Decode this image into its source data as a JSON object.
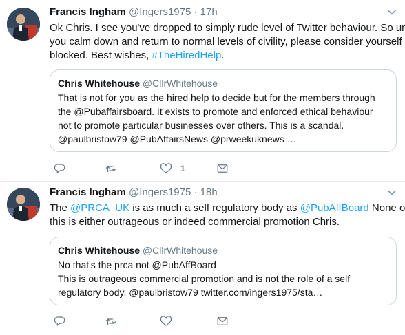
{
  "tweets": [
    {
      "author": {
        "name": "Francis Ingham",
        "handle": "@Ingers1975",
        "dot": "·",
        "time": "17h"
      },
      "text_lines": [
        [
          {
            "t": "Ok Chris. I see you've dropped to simply rude level of Twitter behaviour. So until"
          }
        ],
        [
          {
            "t": "you calm down and return to normal levels of civility, please consider yourself"
          }
        ],
        [
          {
            "t": "blocked. Best wishes, "
          },
          {
            "t": "#TheHiredHelp",
            "link": true
          },
          {
            "t": "."
          }
        ]
      ],
      "quote": {
        "name": "Chris Whitehouse",
        "handle": "@CllrWhitehouse",
        "lines": [
          "That is not for you as the hired help to decide but for the members through",
          "the @Pubaffairsboard. It exists to promote and enforced ethical behaviour",
          "not to promote particular businesses over others. This is a scandal.",
          "@paulbristow79 @PubAffairsNews @prweekuknews …"
        ]
      },
      "actions": {
        "reply_count": "",
        "retweet_count": "",
        "like_count": "1"
      }
    },
    {
      "author": {
        "name": "Francis Ingham",
        "handle": "@Ingers1975",
        "dot": "·",
        "time": "18h"
      },
      "text_lines": [
        [
          {
            "t": "The "
          },
          {
            "t": "@PRCA_UK",
            "link": true
          },
          {
            "t": " is as much a self regulatory body as "
          },
          {
            "t": "@PubAffBoard",
            "link": true
          },
          {
            "t": " None of"
          }
        ],
        [
          {
            "t": "this is either outrageous or indeed commercial promotion Chris."
          }
        ]
      ],
      "quote": {
        "name": "Chris Whitehouse",
        "handle": "@CllrWhitehouse",
        "lines": [
          "No that's the prca not @PubAffBoard",
          "This is outrageous commercial promotion and is not the role of a self",
          "regulatory body. @paulbristow79 twitter.com/ingers1975/sta…"
        ]
      },
      "actions": {
        "reply_count": "",
        "retweet_count": "",
        "like_count": ""
      }
    }
  ],
  "icons": {
    "reply": "reply-icon",
    "retweet": "retweet-icon",
    "like": "heart-icon",
    "dm": "envelope-icon",
    "caret": "chevron-down-icon"
  },
  "colors": {
    "link": "#1da1f2",
    "secondary_text": "#657786",
    "border": "#e6ecf0",
    "quote_border": "#ccd6dd"
  }
}
